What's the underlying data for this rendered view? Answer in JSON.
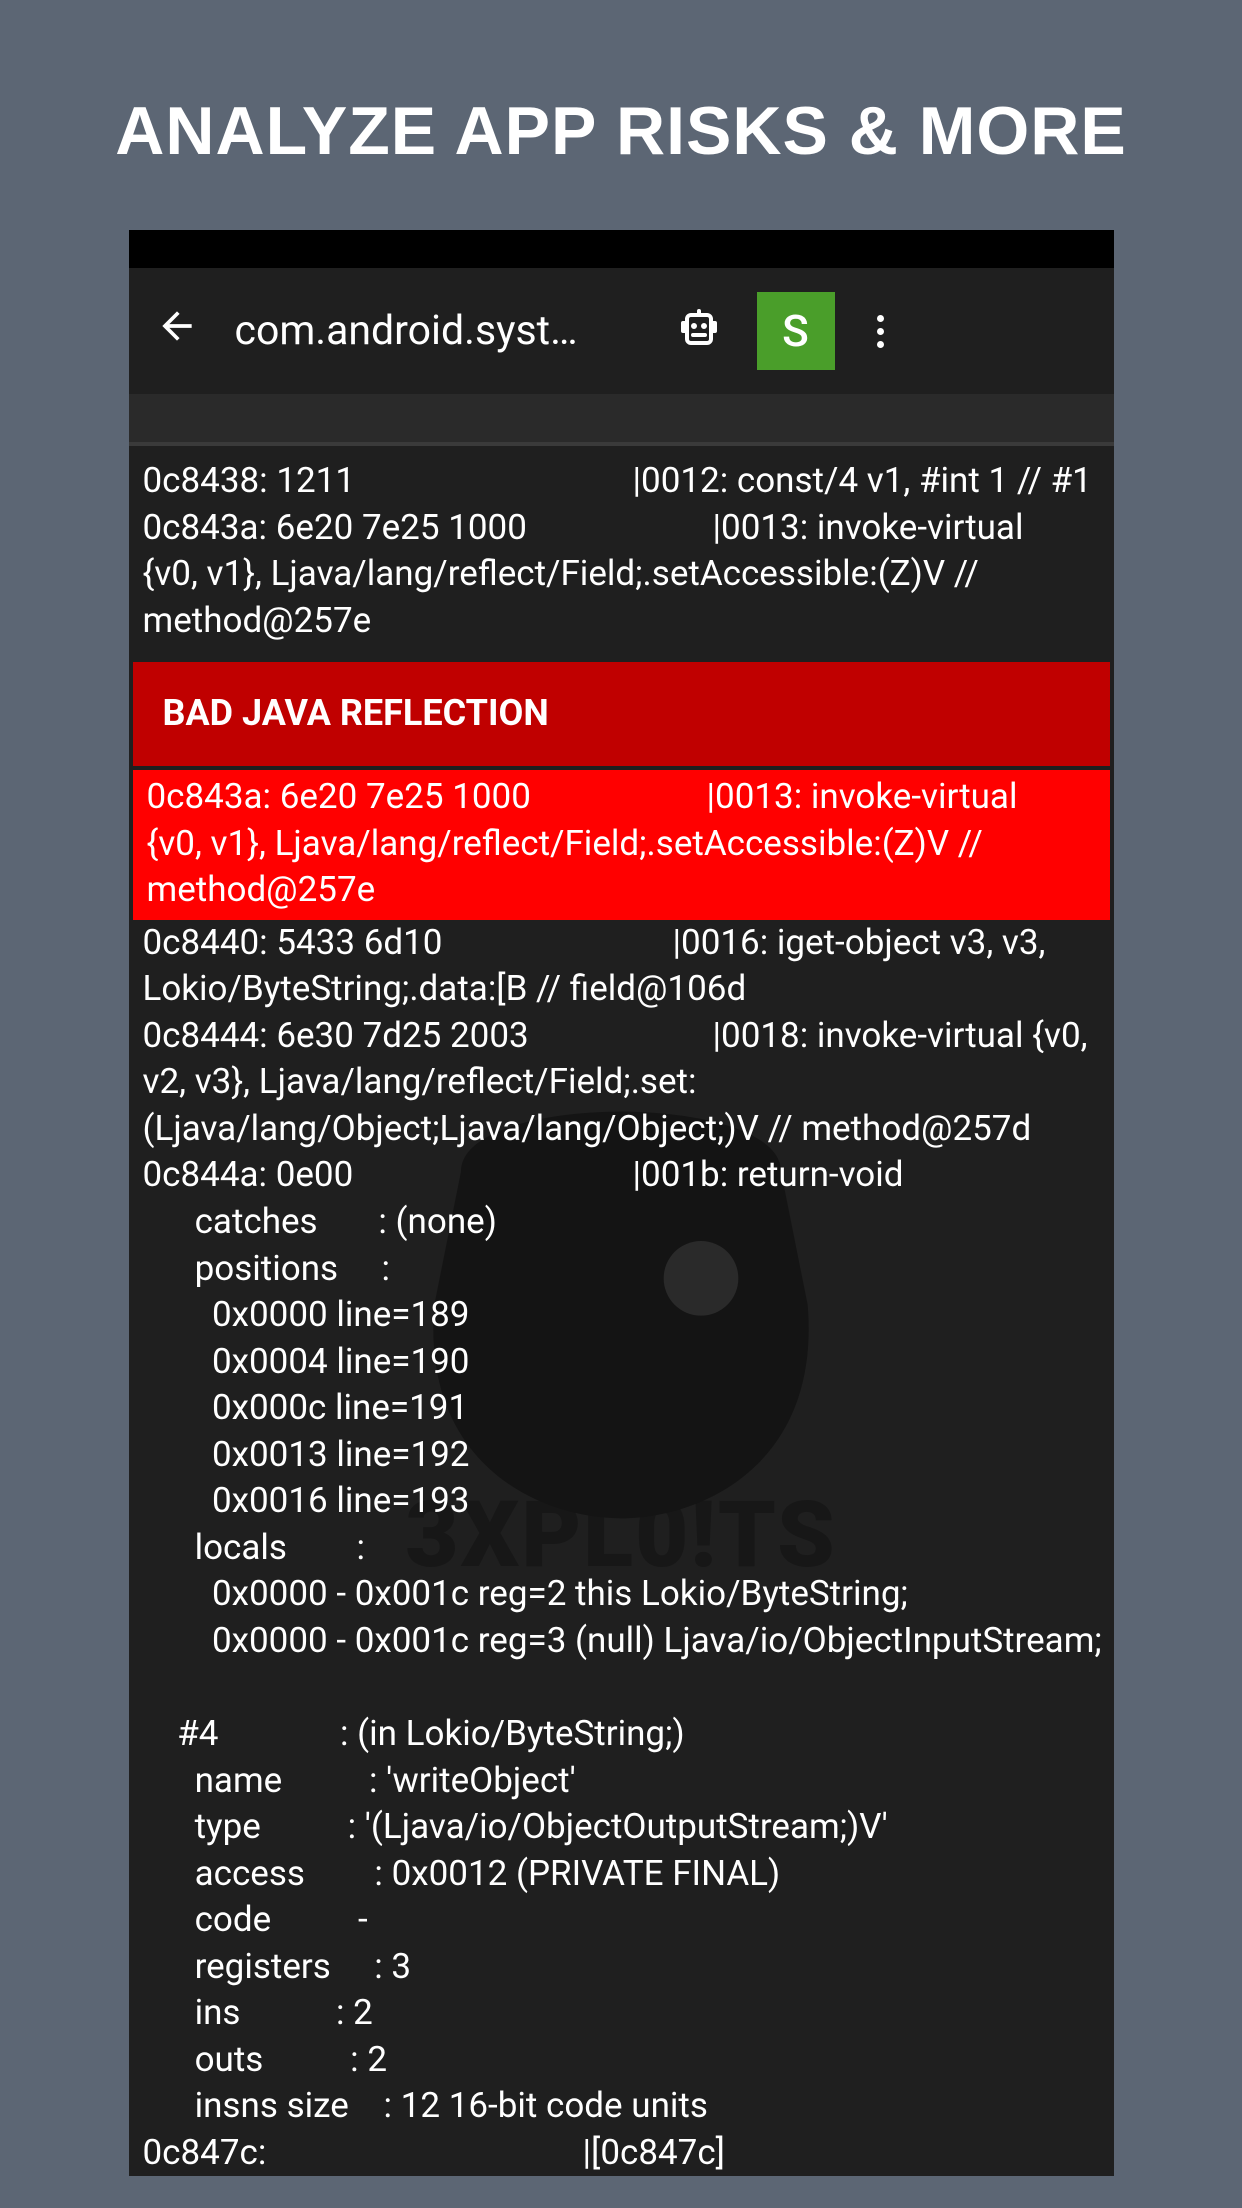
{
  "hero": {
    "title": "ANALYZE APP RISKS & MORE"
  },
  "appbar": {
    "title": "com.android.syst…",
    "badge": "S"
  },
  "watermark": {
    "text": "3XPL0!TS"
  },
  "alert": {
    "heading": "BAD JAVA REFLECTION",
    "body_l1_left": "0c843a: 6e20 7e25 1000",
    "body_l1_right": "|0013: invoke-virtual",
    "body_l2": "{v0, v1}, Ljava/lang/reflect/Field;.setAccessible:(Z)V // method@257e"
  },
  "code": {
    "l1_left": "0c8438: 1211",
    "l1_right": "|0012: const/4 v1, #int 1 // #1",
    "l2_left": "0c843a: 6e20 7e25 1000",
    "l2_right": "|0013: invoke-virtual",
    "l3": "{v0, v1}, Ljava/lang/reflect/Field;.setAccessible:(Z)V // method@257e",
    "l4_left": "0c8440: 5433 6d10",
    "l4_right": "|0016: iget-object v3, v3,",
    "l5": "Lokio/ByteString;.data:[B // field@106d",
    "l6_left": "0c8444: 6e30 7d25 2003",
    "l6_right": "|0018: invoke-virtual {v0,",
    "l7": "v2, v3}, Ljava/lang/reflect/Field;.set:(Ljava/lang/Object;Ljava/lang/Object;)V // method@257d",
    "l8_left": "0c844a: 0e00",
    "l8_right": "|001b: return-void",
    "catches": "      catches       : (none)",
    "positions": "      positions     :",
    "pos1": "        0x0000 line=189",
    "pos2": "        0x0004 line=190",
    "pos3": "        0x000c line=191",
    "pos4": "        0x0013 line=192",
    "pos5": "        0x0016 line=193",
    "locals": "      locals        :",
    "loc1": "        0x0000 - 0x001c reg=2 this Lokio/ByteString;",
    "loc2": "        0x0000 - 0x001c reg=3 (null) Ljava/io/ObjectInputStream;",
    "blank": " ",
    "m_head": "    #4              : (in Lokio/ByteString;)",
    "m_name": "      name          : 'writeObject'",
    "m_type": "      type          : '(Ljava/io/ObjectOutputStream;)V'",
    "m_access": "      access        : 0x0012 (PRIVATE FINAL)",
    "m_code": "      code          -",
    "m_regs": "      registers     : 3",
    "m_ins": "      ins           : 2",
    "m_outs": "      outs          : 2",
    "m_insns": "      insns size    : 12 16-bit code units",
    "foot_left": "0c847c:",
    "foot_right": "|[0c847c]"
  }
}
